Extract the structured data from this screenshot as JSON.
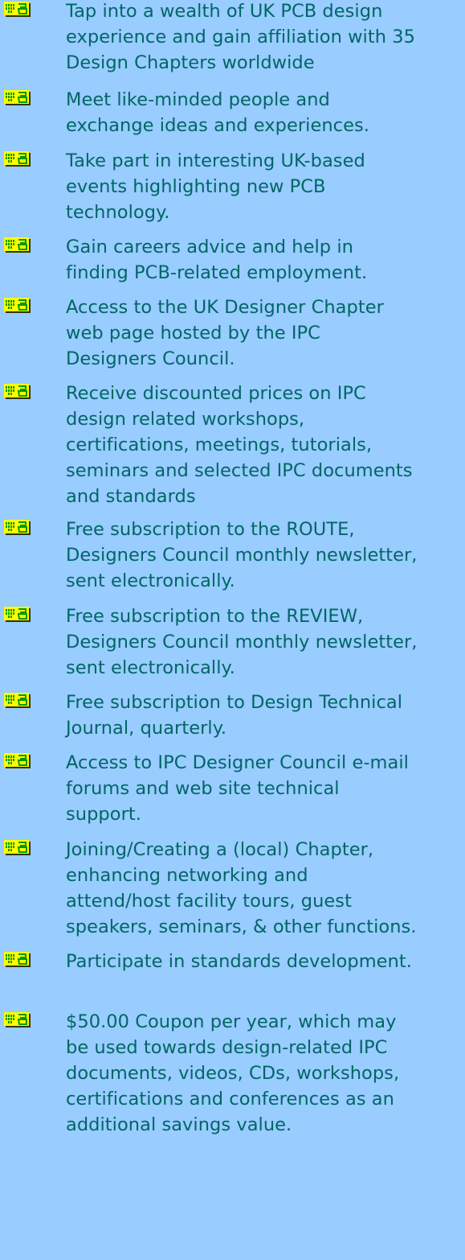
{
  "colors": {
    "background": "#99ccff",
    "text": "#006666",
    "bullet_fill": "#ffff00",
    "bullet_shadow": "#333300",
    "bullet_trace": "#009900"
  },
  "bullet_icon": "pcb-chip-icon",
  "items": [
    {
      "lines": [
        "Tap into a wealth of UK PCB design",
        "experience and gain affiliation with 35",
        "Design Chapters worldwide"
      ]
    },
    {
      "lines": [
        "Meet like-minded people and",
        "exchange ideas and experiences."
      ]
    },
    {
      "lines": [
        "Take part in interesting UK-based",
        "events highlighting new PCB",
        "technology."
      ]
    },
    {
      "lines": [
        "Gain careers advice and help in",
        "finding PCB-related employment."
      ]
    },
    {
      "lines": [
        "Access to the UK Designer Chapter",
        "web page hosted by the IPC",
        "Designers Council."
      ]
    },
    {
      "lines": [
        "Receive discounted prices on IPC",
        "design related workshops,",
        "certifications, meetings, tutorials,",
        "seminars and selected IPC documents",
        "and standards"
      ]
    },
    {
      "lines": [
        "Free subscription to the ROUTE,",
        "Designers Council monthly newsletter,",
        "sent electronically."
      ]
    },
    {
      "lines": [
        "Free subscription to the REVIEW,",
        "Designers Council monthly newsletter,",
        "sent electronically."
      ]
    },
    {
      "lines": [
        "Free subscription to Design Technical",
        "Journal, quarterly."
      ]
    },
    {
      "lines": [
        "Access to IPC Designer Council e-mail",
        "forums and web site technical",
        "support."
      ]
    },
    {
      "lines": [
        "Joining/Creating a (local) Chapter,",
        "enhancing networking and",
        "attend/host facility tours, guest",
        "speakers, seminars, & other functions."
      ]
    },
    {
      "lines": [
        "Participate in standards development."
      ]
    },
    {
      "lines": [
        "$50.00 Coupon per year, which may",
        "be used towards design-related IPC",
        "documents, videos, CDs, workshops,",
        "certifications and conferences as an",
        "additional savings value."
      ]
    }
  ]
}
